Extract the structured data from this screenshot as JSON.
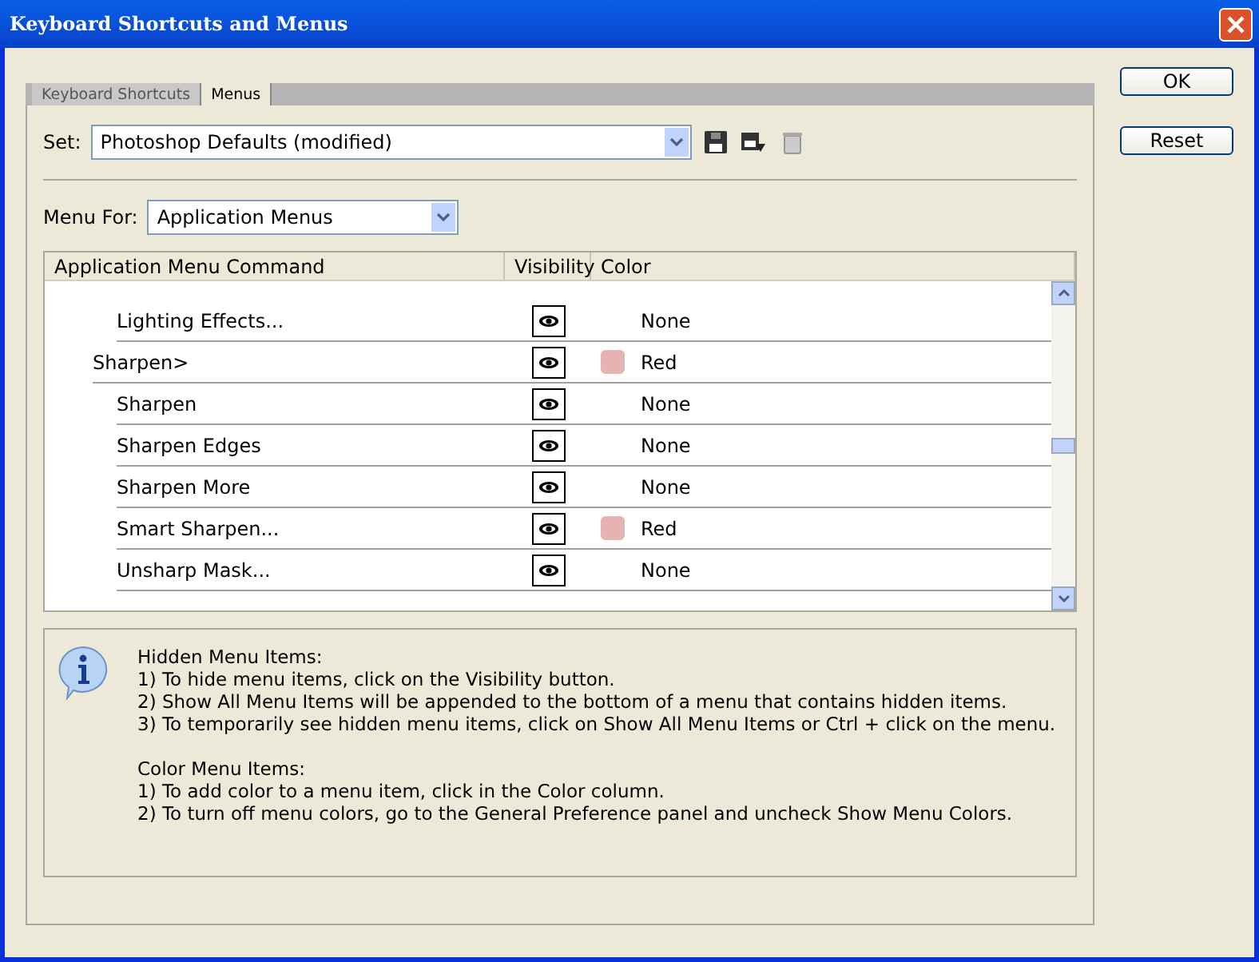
{
  "window": {
    "title": "Keyboard Shortcuts and Menus"
  },
  "tabs": [
    {
      "label": "Keyboard Shortcuts",
      "selected": false
    },
    {
      "label": "Menus",
      "selected": true
    }
  ],
  "set": {
    "label": "Set:",
    "value": "Photoshop Defaults (modified)"
  },
  "menu_for": {
    "label": "Menu For:",
    "value": "Application Menus"
  },
  "table": {
    "columns": [
      "Application Menu Command",
      "Visibility",
      "Color"
    ],
    "rows": [
      {
        "children": [
          {
            "label": "Lighting Effects...",
            "visible": true,
            "color_name": "None"
          }
        ]
      },
      {
        "label": "Sharpen>",
        "visible": true,
        "color_name": "Red",
        "color": "#e6b3b3",
        "children": [
          {
            "label": "Sharpen",
            "visible": true,
            "color_name": "None"
          },
          {
            "label": "Sharpen Edges",
            "visible": true,
            "color_name": "None"
          },
          {
            "label": "Sharpen More",
            "visible": true,
            "color_name": "None"
          },
          {
            "label": "Smart Sharpen...",
            "visible": true,
            "color_name": "Red",
            "color": "#e6b3b3"
          },
          {
            "label": "Unsharp Mask...",
            "visible": true,
            "color_name": "None"
          }
        ]
      }
    ]
  },
  "info": {
    "paragraphs": [
      [
        "Hidden Menu Items:",
        "1) To hide menu items, click on the Visibility button.",
        "2) Show All Menu Items will be appended to the bottom of a menu that contains hidden items.",
        "3) To temporarily see hidden menu items, click on Show All Menu Items or Ctrl + click on the menu."
      ],
      [
        "Color Menu Items:",
        "1) To add color to a menu item, click in the Color column.",
        "2) To turn off menu colors, go to the General Preference panel and uncheck Show Menu Colors."
      ]
    ]
  },
  "buttons": [
    "OK",
    "Reset"
  ]
}
